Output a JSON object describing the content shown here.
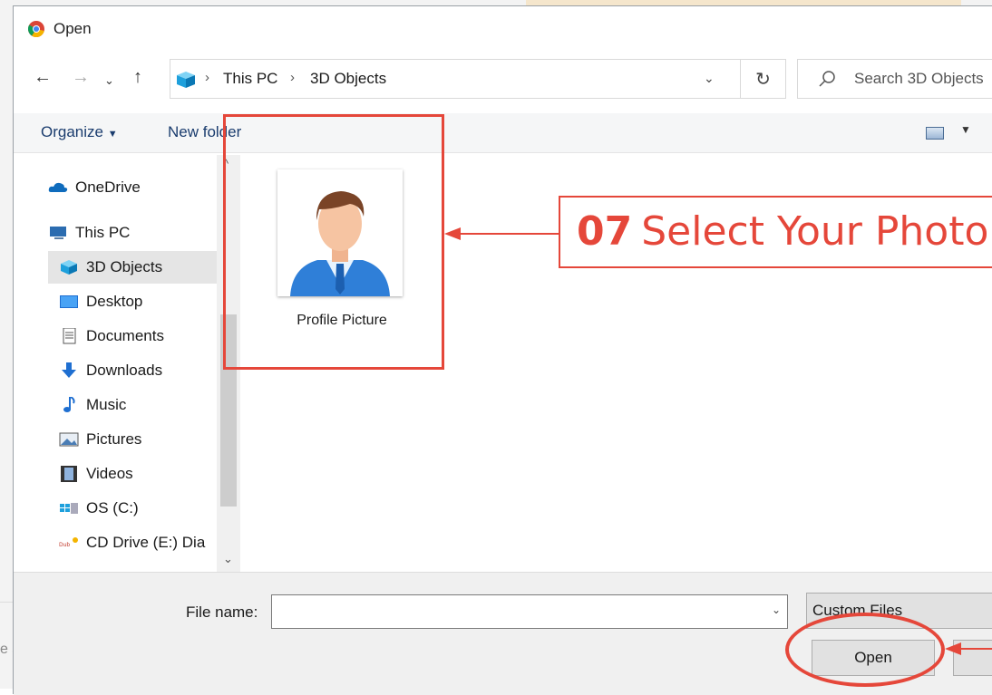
{
  "dialog": {
    "title": "Open"
  },
  "nav": {
    "breadcrumbs": [
      "This PC",
      "3D Objects"
    ],
    "search_placeholder": "Search 3D Objects"
  },
  "toolbar": {
    "organize_label": "Organize",
    "new_folder_label": "New folder"
  },
  "sidebar": {
    "items": [
      {
        "label": "OneDrive",
        "icon": "cloud-icon"
      },
      {
        "label": "This PC",
        "icon": "computer-icon"
      },
      {
        "label": "3D Objects",
        "icon": "cube-icon",
        "selected": true
      },
      {
        "label": "Desktop",
        "icon": "desktop-icon"
      },
      {
        "label": "Documents",
        "icon": "document-icon"
      },
      {
        "label": "Downloads",
        "icon": "download-arrow-icon"
      },
      {
        "label": "Music",
        "icon": "music-note-icon"
      },
      {
        "label": "Pictures",
        "icon": "picture-icon"
      },
      {
        "label": "Videos",
        "icon": "film-icon"
      },
      {
        "label": "OS (C:)",
        "icon": "windows-drive-icon"
      },
      {
        "label": "CD Drive (E:) Dia",
        "icon": "cd-drive-icon"
      }
    ]
  },
  "files": [
    {
      "name": "Profile Picture",
      "icon": "profile-avatar-icon"
    }
  ],
  "bottom": {
    "file_name_label": "File name:",
    "file_name_value": "",
    "filter_label": "Custom Files",
    "open_label": "Open"
  },
  "background": {
    "partial_text": "e s"
  },
  "annotations": {
    "step_number": "07",
    "step_text": "Select Your Photo",
    "color": "#e5473a"
  }
}
